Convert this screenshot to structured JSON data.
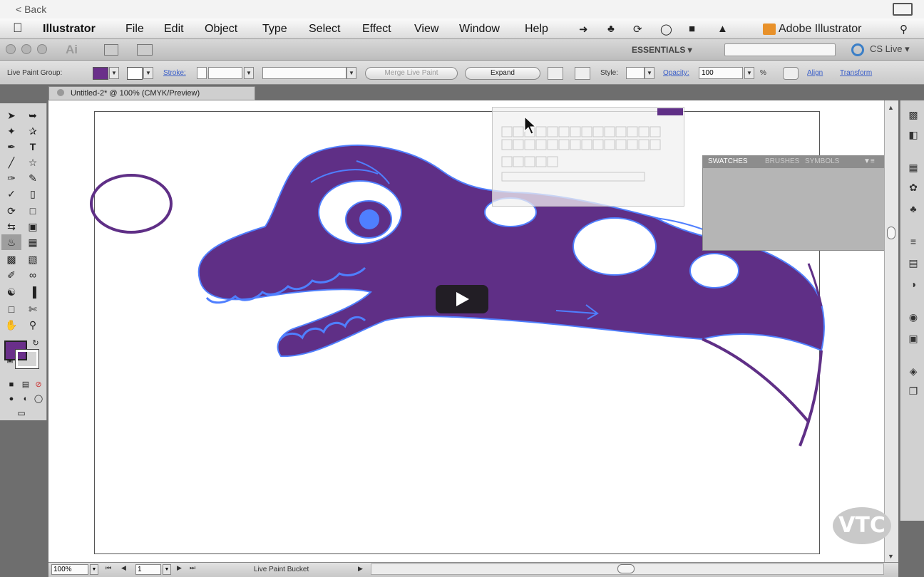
{
  "top": {
    "back_label": "< Back"
  },
  "menubar": {
    "items": [
      "Illustrator",
      "File",
      "Edit",
      "Object",
      "Type",
      "Select",
      "Effect",
      "View",
      "Window",
      "Help"
    ],
    "app_title": "Adobe Illustrator"
  },
  "appbar": {
    "logo": "Ai",
    "essentials": "ESSENTIALS ▾",
    "cslive": "CS Live ▾"
  },
  "control": {
    "group_label": "Live Paint Group:",
    "stroke_label": "Stroke:",
    "merge_button": "Merge Live Paint",
    "expand_button": "Expand",
    "style_label": "Style:",
    "opacity_label": "Opacity:",
    "opacity_value": "100",
    "percent": "%",
    "align_link": "Align",
    "transform_link": "Transform",
    "fill_color": "#6a2f8a"
  },
  "document": {
    "tab_title": "Untitled-2* @ 100% (CMYK/Preview)"
  },
  "panel": {
    "tabs": [
      "SWATCHES",
      "BRUSHES",
      "SYMBOLS"
    ]
  },
  "status": {
    "zoom": "100%",
    "page": "1",
    "tool": "Live Paint Bucket"
  },
  "watermark": "VTC",
  "colors": {
    "artwork": "#5f2f86",
    "anchor": "#4f7fff"
  }
}
